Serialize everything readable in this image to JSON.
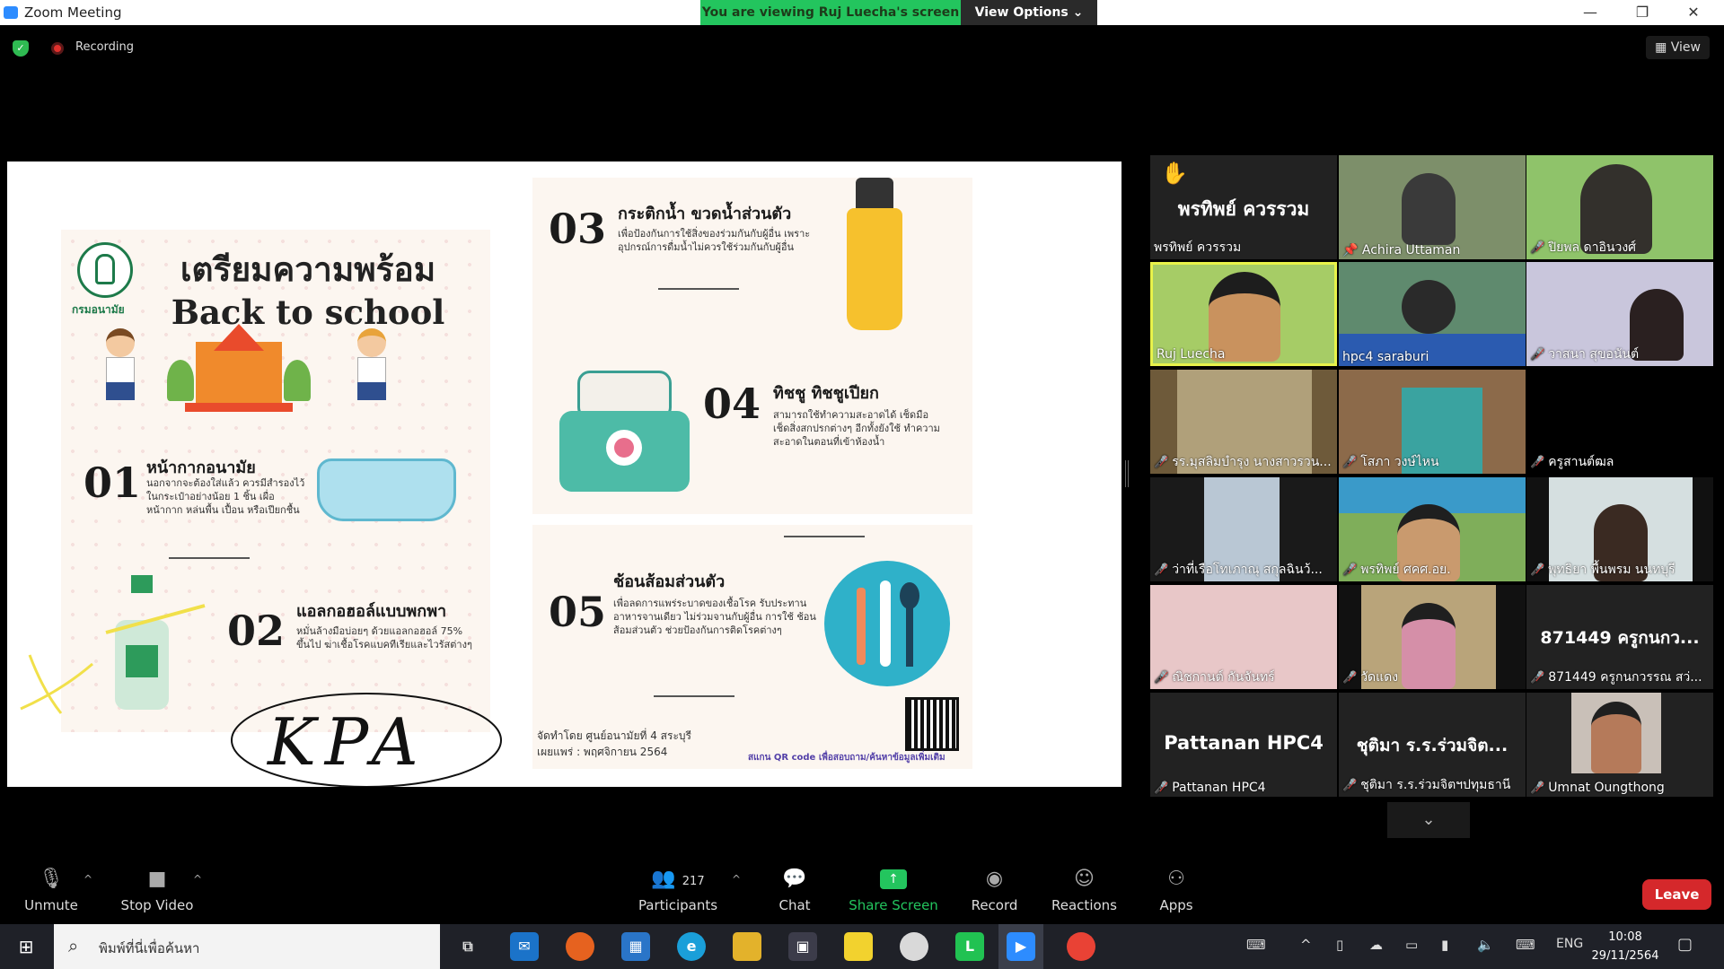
{
  "window": {
    "title": "Zoom Meeting",
    "minimize": "—",
    "restore": "❐",
    "close": "✕"
  },
  "banner": {
    "viewing": "You are viewing Ruj Luecha's screen",
    "view_options": "View Options ⌄"
  },
  "meeting": {
    "recording": "Recording",
    "view": "View"
  },
  "poster": {
    "org": "กรมอนามัย",
    "title_line1": "เตรียมความพร้อม",
    "title_line2": "Back to school",
    "items": [
      {
        "num": "01",
        "title": "หน้ากากอนามัย",
        "text": "นอกจากจะต้องใส่แล้ว ควรมีสำรองไว้ ในกระเป๋าอย่างน้อย 1 ชิ้น เผื่อหน้ากาก หล่นพื้น เปื้อน หรือเปียกชื้น"
      },
      {
        "num": "02",
        "title": "แอลกอฮอล์แบบพกพา",
        "text": "หมั่นล้างมือบ่อยๆ ด้วยแอลกอฮอล์ 75% ขึ้นไป ฆ่าเชื้อโรคแบคทีเรียและไวรัสต่างๆ"
      },
      {
        "num": "03",
        "title": "กระติกน้ำ ขวดน้ำส่วนตัว",
        "text": "เพื่อป้องกันการใช้สิ่งของร่วมกันกับผู้อื่น เพราะอุปกรณ์การดื่มน้ำไม่ควรใช้ร่วมกันกับผู้อื่น"
      },
      {
        "num": "04",
        "title": "ทิชชู ทิชชูเปียก",
        "text": "สามารถใช้ทำความสะอาดได้ เช็ดมือ เช็ดสิ่งสกปรกต่างๆ อีกทั้งยังใช้ ทำความสะอาดในตอนที่เข้าห้องน้ำ"
      },
      {
        "num": "05",
        "title": "ช้อนส้อมส่วนตัว",
        "text": "เพื่อลดการแพร่ระบาดของเชื้อโรค รับประทาน อาหารจานเดียว ไม่ร่วมจานกับผู้อื่น การใช้ ช้อนส้อมส่วนตัว ช่วยป้องกันการติดโรคต่างๆ"
      }
    ],
    "footer_line1": "จัดทำโดย ศูนย์อนามัยที่ 4 สระบุรี",
    "footer_line2": "เผยแพร่ : พฤศจิกายน 2564",
    "qr_note": "สแกน QR code เพื่อสอบถาม/ค้นหาข้อมูลเพิ่มเติม",
    "scribble": "KPA"
  },
  "participants": [
    {
      "name": "พรทิพย์ ควรรวม",
      "big": "พรทิพย์ ควรรวม",
      "hand": "✋"
    },
    {
      "name": "Achira Uttaman"
    },
    {
      "name": "ปิยพล ดาอินวงศ์"
    },
    {
      "name": "Ruj Luecha"
    },
    {
      "name": "hpc4 saraburi"
    },
    {
      "name": "วาสนา สุขอนันต์"
    },
    {
      "name": "รร.มุสลิมบำรุง นางสาวรวน..."
    },
    {
      "name": "โสภา วงษ์ไหน"
    },
    {
      "name": "ครูสานต์ฒล"
    },
    {
      "name": "ว่าที่เรือโทเภาณุ สกุลฉินว้..."
    },
    {
      "name": "พรทิพย์ ศคศ.อย."
    },
    {
      "name": "พุทธิยา พื้นพรม นนทบุรี"
    },
    {
      "name": "ณิชกานต์ กันจันทร์"
    },
    {
      "name": "วัดแดง"
    },
    {
      "name": "871449 ครูกนกวรรณ สว่...",
      "big": "871449 ครูกนกว..."
    },
    {
      "name": "Pattanan HPC4",
      "big": "Pattanan HPC4"
    },
    {
      "name": "ชุติมา ร.ร.ร่วมจิตฯปทุมธานี",
      "big": "ชุติมา ร.ร.ร่วมจิต..."
    },
    {
      "name": "Umnat Oungthong"
    }
  ],
  "toolbar": {
    "unmute": "Unmute",
    "stop_video": "Stop Video",
    "participants": "Participants",
    "participant_count": "217",
    "chat": "Chat",
    "share": "Share Screen",
    "record": "Record",
    "reactions": "Reactions",
    "apps": "Apps",
    "leave": "Leave"
  },
  "taskbar": {
    "search_placeholder": "พิมพ์ที่นี่เพื่อค้นหา",
    "lang": "ENG",
    "time": "10:08",
    "date": "29/11/2564"
  }
}
